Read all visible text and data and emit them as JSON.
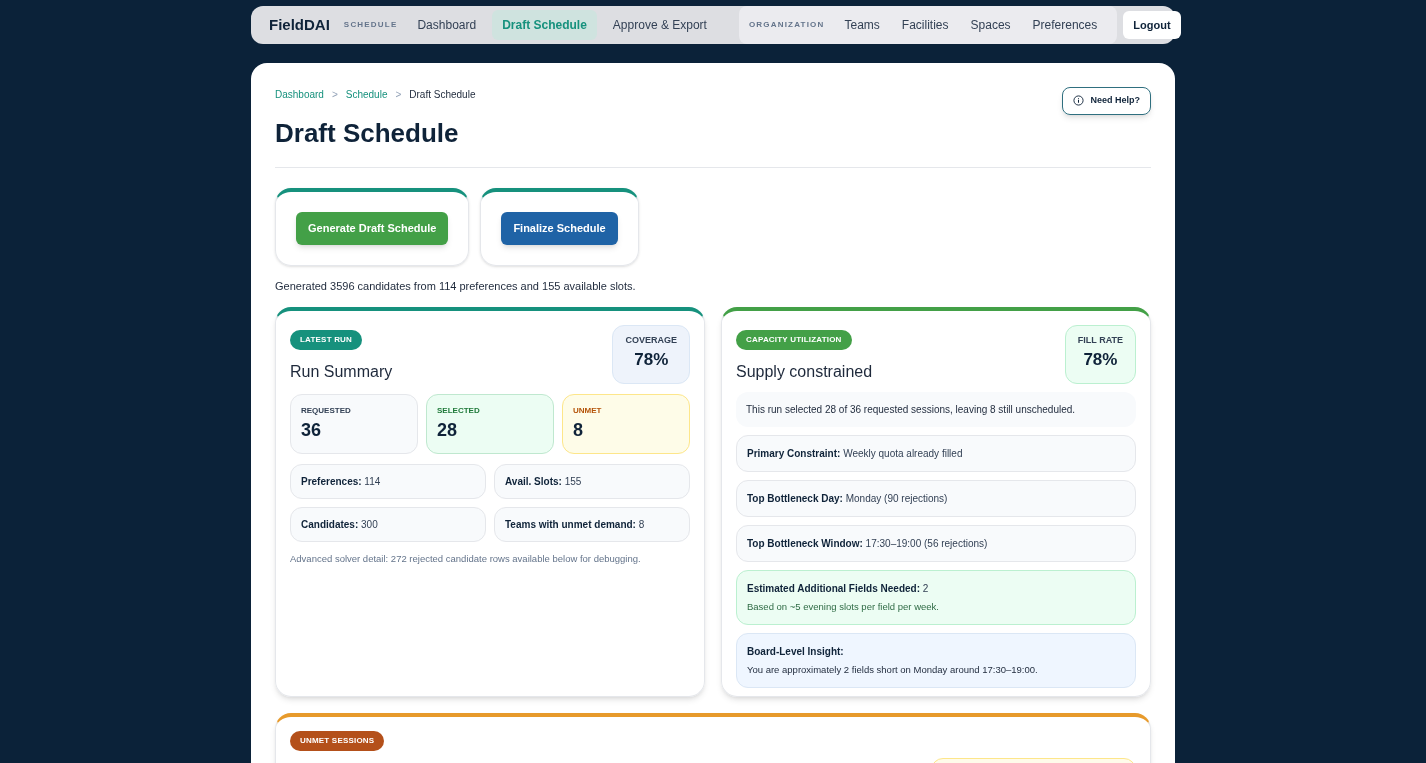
{
  "nav": {
    "brand": "FieldDAI",
    "schedule_group": {
      "label": "SCHEDULE",
      "items": [
        {
          "label": "Dashboard",
          "selected": false
        },
        {
          "label": "Draft Schedule",
          "selected": true
        },
        {
          "label": "Approve & Export",
          "selected": false
        }
      ]
    },
    "organization_group": {
      "label": "ORGANIZATION",
      "items": [
        {
          "label": "Teams",
          "selected": false
        },
        {
          "label": "Facilities",
          "selected": false
        },
        {
          "label": "Spaces",
          "selected": false
        },
        {
          "label": "Preferences",
          "selected": false
        }
      ]
    },
    "logout": "Logout"
  },
  "breadcrumb_separator": ">",
  "breadcrumb": [
    {
      "label": "Dashboard",
      "kind": "link"
    },
    {
      "label": "Schedule",
      "kind": "link"
    },
    {
      "label": "Draft Schedule",
      "kind": "current"
    }
  ],
  "help_button": "Need Help?",
  "title": "Draft Schedule",
  "actions": [
    {
      "label": "Generate Draft Schedule",
      "kind": "generate"
    },
    {
      "label": "Finalize Schedule",
      "kind": "finalize"
    }
  ],
  "status_message": "Generated 3596 candidates from 114 preferences and 155 available slots.",
  "run_summary": {
    "badge": "LATEST RUN",
    "title": "Run Summary",
    "metric": {
      "label": "COVERAGE",
      "value": "78%"
    },
    "stats": [
      {
        "label": "REQUESTED",
        "value": "36",
        "kind": "neutral"
      },
      {
        "label": "SELECTED",
        "value": "28",
        "kind": "good"
      },
      {
        "label": "UNMET",
        "value": "8",
        "kind": "warn"
      }
    ],
    "details": [
      "**Preferences:** 114",
      "**Avail. Slots:** 155",
      "**Candidates:** 300",
      "**Teams with unmet demand:** 8"
    ],
    "note": "Advanced solver detail: 272 rejected candidate rows available below for debugging."
  },
  "capacity": {
    "badge": "CAPACITY UTILIZATION",
    "title": "Supply constrained",
    "metric": {
      "label": "FILL RATE",
      "value": "78%"
    },
    "summary": "This run selected 28 of 36 requested sessions, leaving 8 still unscheduled.",
    "items": [
      {
        "text": "**Primary Constraint:** Weekly quota already filled",
        "kind": "plain"
      },
      {
        "text": "**Top Bottleneck Day:** Monday (90 rejections)",
        "kind": "plain"
      },
      {
        "text": "**Top Bottleneck Window:** 17:30–19:00 (56 rejections)",
        "kind": "plain"
      },
      {
        "text": "**Estimated Additional Fields Needed:** 2",
        "sub": "Based on ~5 evening slots per field per week.",
        "kind": "success"
      },
      {
        "text": "**Board-Level Insight:**",
        "sub": "You are approximately 2 fields short on Monday around 17:30–19:00.",
        "kind": "info"
      }
    ]
  },
  "unmet_section": {
    "badge": "UNMET SESSIONS"
  }
}
